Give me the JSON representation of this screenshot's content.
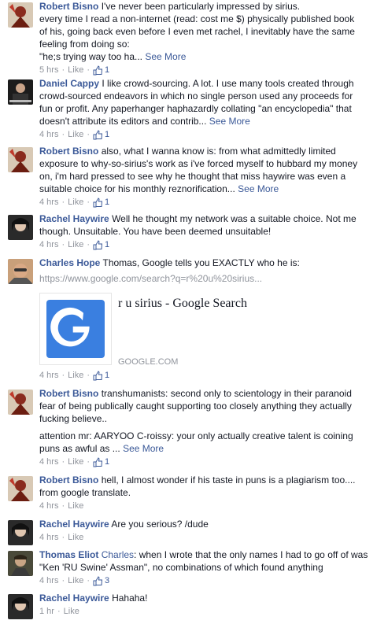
{
  "comments": [
    {
      "author": "Robert Bisno",
      "lines": [
        "I've never been particularly impressed by sirius.",
        "every time I read a non-internet (read: cost me $) physically published book",
        "of his, going back even before I even met rachel, I inevitably have the same",
        "feeling from doing so:",
        "\"he;s trying way too ha..."
      ],
      "see_more": "See More",
      "time": "5 hrs",
      "like": "Like",
      "likes": "1"
    },
    {
      "author": "Daniel Cappy",
      "lines": [
        "I like crowd-sourcing. A lot. I use many tools created through",
        "crowd-sourced endeavors in which no single person used any proceeds for",
        "fun or profit. Any paperhanger haphazardly collating \"an encyclopedia\" that",
        "doesn't attribute its editors and contrib..."
      ],
      "see_more": "See More",
      "time": "4 hrs",
      "like": "Like",
      "likes": "1"
    },
    {
      "author": "Robert Bisno",
      "lines": [
        "also, what I wanna know is: from what admittedly limited",
        "exposure to why-so-sirius's work as i've forced myself to hubbard my money",
        "on, i'm hard pressed to see why he thought that miss haywire was even a",
        "suitable choice for his monthly reznorification..."
      ],
      "see_more": "See More",
      "time": "4 hrs",
      "like": "Like",
      "likes": "1"
    },
    {
      "author": "Rachel Haywire",
      "lines": [
        "Well he thought my network was a suitable choice. Not me",
        "though. Unsuitable. You have been deemed unsuitable!"
      ],
      "time": "4 hrs",
      "like": "Like",
      "likes": "1"
    },
    {
      "author": "Charles Hope",
      "lines": [
        "Thomas, Google tells you EXACTLY who he is:"
      ],
      "url": "https://www.google.com/search?q=r%20u%20sirius...",
      "preview_title": "r u sirius - Google Search",
      "preview_domain": "GOOGLE.COM",
      "time": "4 hrs",
      "like": "Like",
      "likes": "1"
    },
    {
      "author": "Robert Bisno",
      "lines": [
        "transhumanists: second only to scientology in their paranoid",
        "fear of being publically caught supporting too closely anything they actually",
        "fucking believe.."
      ],
      "lines2": [
        "attention mr: AARYOO C-roissy: your only actually creative talent is coining",
        "puns as awful as ..."
      ],
      "see_more": "See More",
      "time": "4 hrs",
      "like": "Like",
      "likes": "1"
    },
    {
      "author": "Robert Bisno",
      "lines": [
        "hell, I almost wonder if his taste in puns is a plagiarism too....",
        "from google translate."
      ],
      "time": "4 hrs",
      "like": "Like"
    },
    {
      "author": "Rachel Haywire",
      "lines": [
        "Are you serious? /dude"
      ],
      "time": "4 hrs",
      "like": "Like"
    },
    {
      "author": "Thomas Eliot",
      "mention": "Charles",
      "lines": [
        ": when I wrote that the only names I had to go off of was",
        "\"Ken 'RU Swine' Assman\", no combinations of which found anything"
      ],
      "time": "4 hrs",
      "like": "Like",
      "likes": "3"
    },
    {
      "author": "Rachel Haywire",
      "lines": [
        "Hahaha!"
      ],
      "time": "1 hr",
      "like": "Like"
    }
  ],
  "colors": {
    "link": "#3b5998",
    "meta": "#90949c",
    "text": "#141823",
    "google_blue": "#3a7fe0"
  }
}
